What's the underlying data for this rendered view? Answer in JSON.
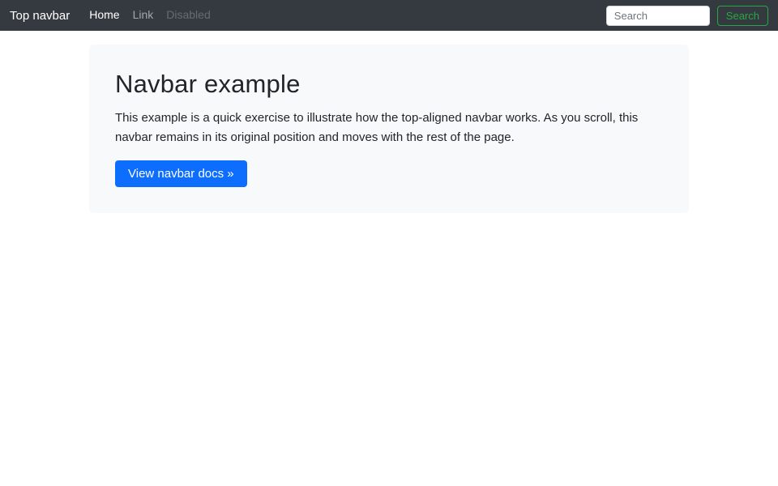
{
  "navbar": {
    "brand": "Top navbar",
    "links": [
      {
        "label": "Home",
        "state": "active"
      },
      {
        "label": "Link",
        "state": "default"
      },
      {
        "label": "Disabled",
        "state": "disabled"
      }
    ],
    "search": {
      "placeholder": "Search",
      "button_label": "Search"
    }
  },
  "main": {
    "title": "Navbar example",
    "description": "This example is a quick exercise to illustrate how the top-aligned navbar works. As you scroll, this navbar remains in its original position and moves with the rest of the page.",
    "cta_label": "View navbar docs »"
  },
  "colors": {
    "navbar_bg": "#343a40",
    "jumbotron_bg": "#f8f9fa",
    "primary": "#0d6efd",
    "success": "#28a745",
    "text": "#212529",
    "nav_link_muted": "rgba(255,255,255,0.55)",
    "nav_link_disabled": "rgba(255,255,255,0.25)"
  }
}
